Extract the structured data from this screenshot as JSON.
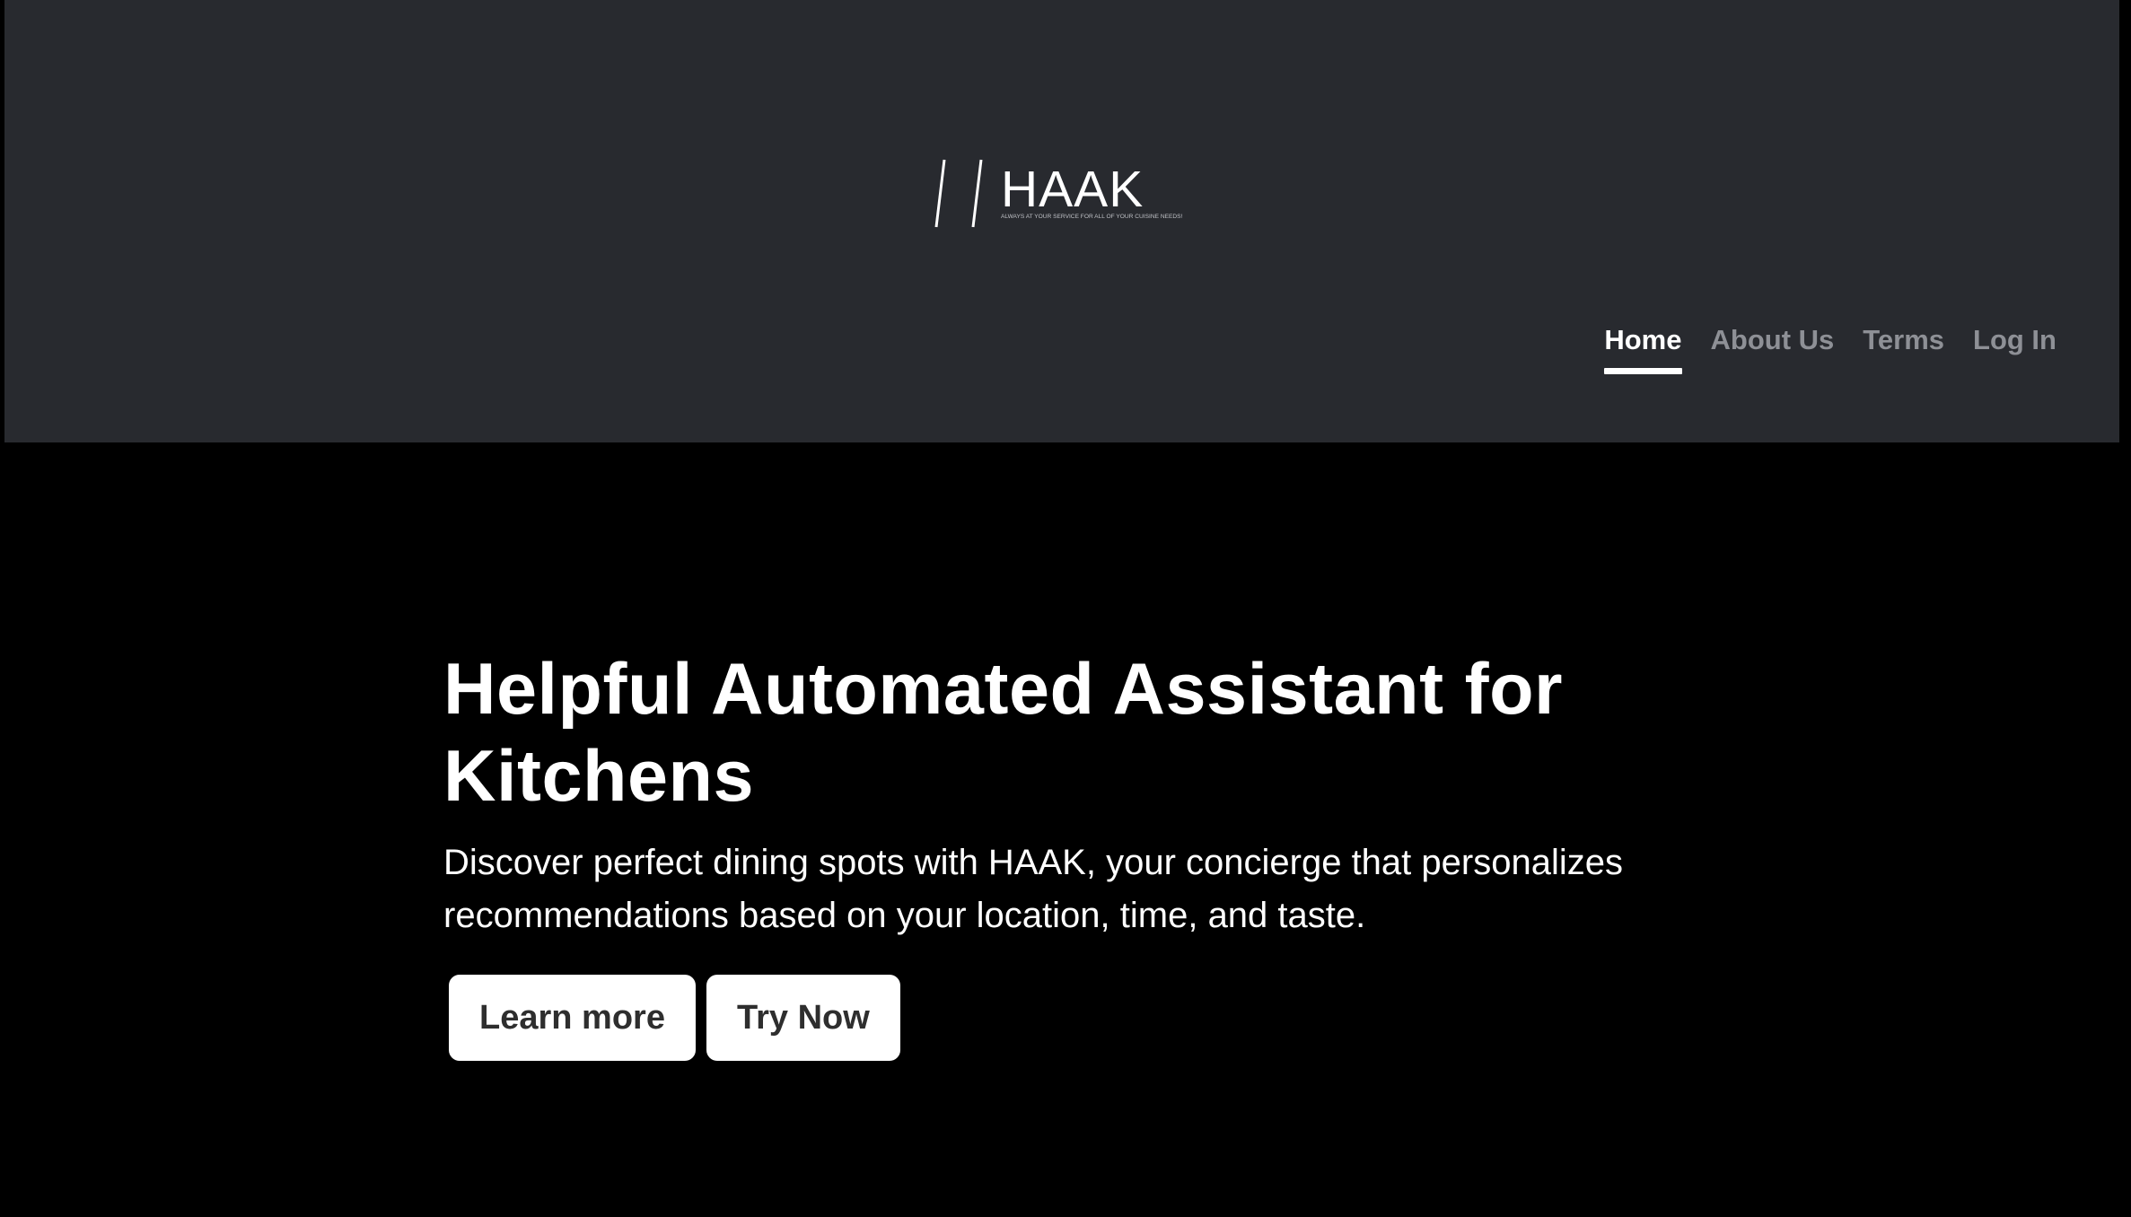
{
  "brand": {
    "name": "HAAK",
    "tagline": "ALWAYS AT YOUR SERVICE FOR ALL OF YOUR CUISINE NEEDS!",
    "colors": {
      "header_bg": "#282a2f",
      "page_bg": "#000000",
      "nav_inactive": "#8e9096",
      "button_text": "#2e2e2e"
    }
  },
  "nav": {
    "items": [
      {
        "label": "Home",
        "active": true
      },
      {
        "label": "About Us",
        "active": false
      },
      {
        "label": "Terms",
        "active": false
      },
      {
        "label": "Log In",
        "active": false
      }
    ]
  },
  "hero": {
    "title": "Helpful Automated Assistant for Kitchens",
    "description": "Discover perfect dining spots with HAAK, your concierge that personalizes recommendations based on your location, time, and taste.",
    "buttons": {
      "learn_more": "Learn more",
      "try_now": "Try Now"
    }
  }
}
